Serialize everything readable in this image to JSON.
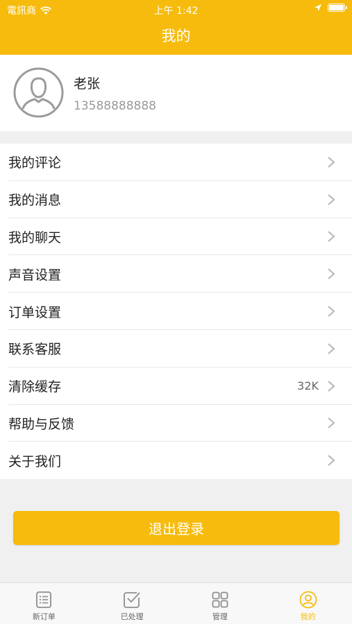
{
  "status_bar": {
    "carrier": "電訊商",
    "time": "上午 1:42"
  },
  "header": {
    "title": "我的"
  },
  "profile": {
    "name": "老张",
    "phone": "13588888888"
  },
  "menu": {
    "items": [
      {
        "label": "我的评论",
        "value": ""
      },
      {
        "label": "我的消息",
        "value": ""
      },
      {
        "label": "我的聊天",
        "value": ""
      },
      {
        "label": "声音设置",
        "value": ""
      },
      {
        "label": "订单设置",
        "value": ""
      },
      {
        "label": "联系客服",
        "value": ""
      },
      {
        "label": "清除缓存",
        "value": "32K"
      },
      {
        "label": "帮助与反馈",
        "value": ""
      },
      {
        "label": "关于我们",
        "value": ""
      }
    ]
  },
  "logout": {
    "label": "退出登录"
  },
  "tabbar": {
    "tabs": [
      {
        "label": "新订单",
        "icon": "list-icon"
      },
      {
        "label": "已处理",
        "icon": "processed-icon"
      },
      {
        "label": "管理",
        "icon": "grid-icon"
      },
      {
        "label": "我的",
        "icon": "user-icon"
      }
    ],
    "active_color": "#f6bb0c"
  },
  "colors": {
    "brand": "#f6bb0c",
    "background": "#f0f0f0"
  }
}
